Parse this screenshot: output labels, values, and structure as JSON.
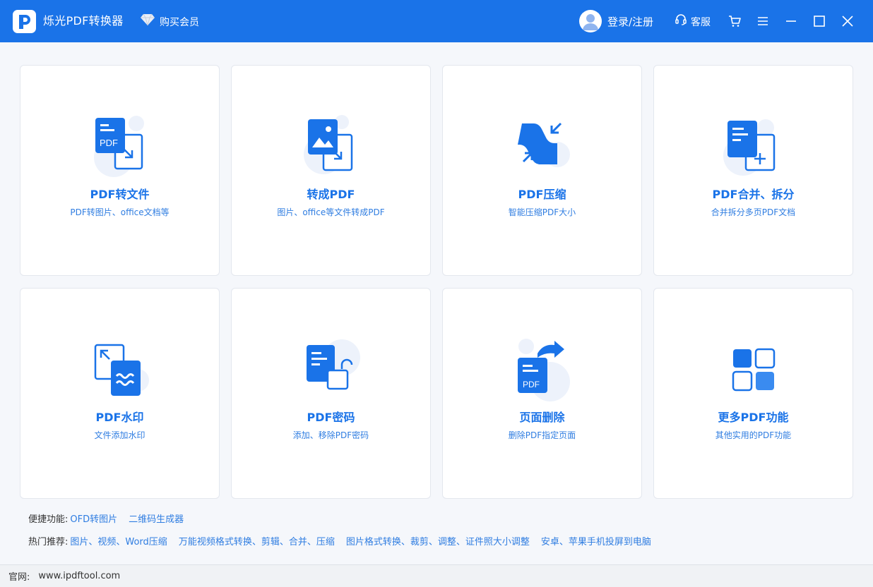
{
  "window": {
    "title": "烁光PDF转换器",
    "vip_label": "购买会员",
    "login_label": "登录/注册",
    "service_label": "客服"
  },
  "colors": {
    "primary": "#1a73e8",
    "accent": "#2f7de1",
    "card_bg": "#ffffff",
    "page_bg": "#f5f7fb"
  },
  "cards": [
    {
      "title": "PDF转文件",
      "desc": "PDF转图片、office文档等",
      "icon": "pdf-to-file-icon",
      "icon_text": "PDF"
    },
    {
      "title": "转成PDF",
      "desc": "图片、office等文件转成PDF",
      "icon": "to-pdf-icon"
    },
    {
      "title": "PDF压缩",
      "desc": "智能压缩PDF大小",
      "icon": "pdf-compress-icon"
    },
    {
      "title": "PDF合并、拆分",
      "desc": "合并拆分多页PDF文档",
      "icon": "pdf-merge-split-icon"
    },
    {
      "title": "PDF水印",
      "desc": "文件添加水印",
      "icon": "pdf-watermark-icon"
    },
    {
      "title": "PDF密码",
      "desc": "添加、移除PDF密码",
      "icon": "pdf-password-icon"
    },
    {
      "title": "页面删除",
      "desc": "删除PDF指定页面",
      "icon": "page-delete-icon",
      "icon_text": "PDF"
    },
    {
      "title": "更多PDF功能",
      "desc": "其他实用的PDF功能",
      "icon": "more-functions-icon"
    }
  ],
  "quick": {
    "label": "便捷功能:",
    "links": [
      "OFD转图片",
      "二维码生成器"
    ]
  },
  "hot": {
    "label": "热门推荐:",
    "links": [
      "图片、视频、Word压缩",
      "万能视频格式转换、剪辑、合并、压缩",
      "图片格式转换、裁剪、调整、证件照大小调整",
      "安卓、苹果手机投屏到电脑"
    ]
  },
  "footer": {
    "label": "官网:",
    "url": "www.ipdftool.com"
  }
}
